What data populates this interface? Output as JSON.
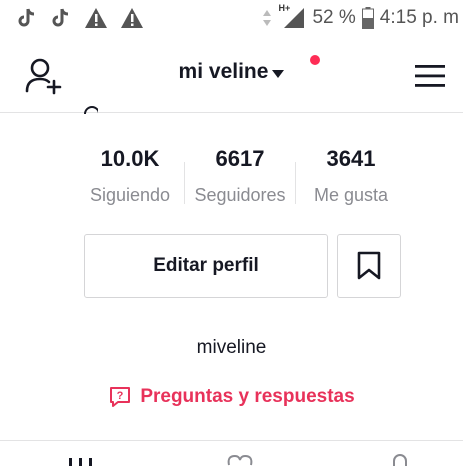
{
  "status_bar": {
    "icons": [
      "tiktok-icon",
      "tiktok-icon",
      "warning-icon",
      "warning-icon",
      "data-arrows-icon",
      "signal-h-plus-icon",
      "battery-icon"
    ],
    "network": "H+",
    "battery": "52 %",
    "time": "4:15 p. m"
  },
  "header": {
    "username": "mi veline",
    "notification_color": "#fe2c55"
  },
  "stats": [
    {
      "value": "10.0K",
      "label": "Siguiendo"
    },
    {
      "value": "6617",
      "label": "Seguidores"
    },
    {
      "value": "3641",
      "label": "Me gusta"
    }
  ],
  "actions": {
    "edit_profile": "Editar perfil",
    "bookmark_icon": "bookmark-icon"
  },
  "bio": "miveline",
  "qa_link": {
    "label": "Preguntas y respuestas",
    "color": "#e8325a",
    "icon": "question-bubble-icon"
  },
  "bottom_tabs": [
    "grid-icon",
    "heart-icon",
    "lock-icon"
  ]
}
